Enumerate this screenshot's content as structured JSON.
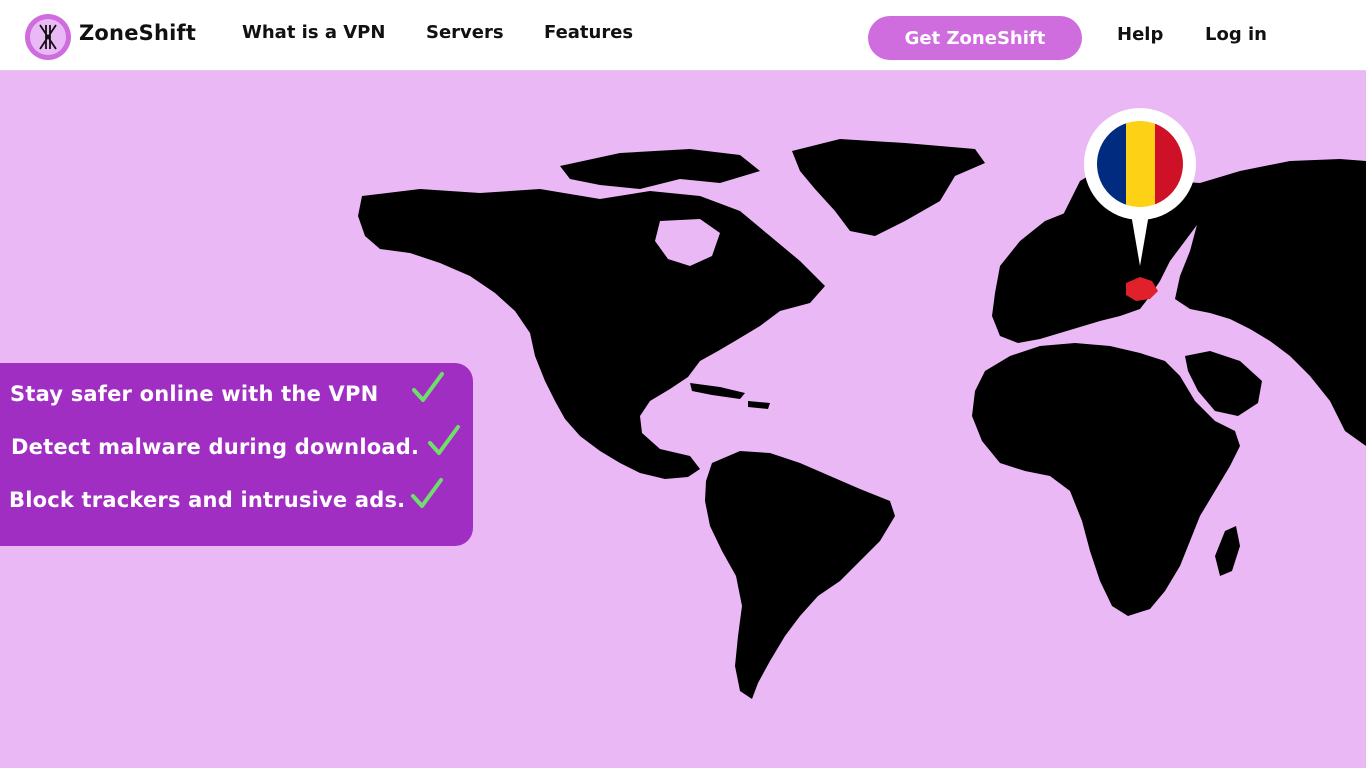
{
  "brand": {
    "name": "ZoneShift",
    "logo_icon": "zoneshift-logo-icon"
  },
  "nav": {
    "what_is_vpn": "What is a VPN",
    "servers": "Servers",
    "features": "Features",
    "cta": "Get ZoneShift",
    "help": "Help",
    "login": "Log in"
  },
  "features": [
    {
      "text": "Stay safer online with the VPN",
      "icon": "check-icon"
    },
    {
      "text": "Detect malware during download.",
      "icon": "check-icon"
    },
    {
      "text": "Block trackers and intrusive ads.",
      "icon": "check-icon"
    }
  ],
  "map": {
    "icon": "world-map",
    "selected_country_flag": "romania-flag-icon",
    "flag_colors": [
      "#002b7f",
      "#fcd116",
      "#ce1126"
    ]
  },
  "colors": {
    "accent": "#cf6ddf",
    "background": "#ebb8f6",
    "card": "#a12ec3",
    "check": "#6ee06a",
    "land": "#000000",
    "highlight": "#e0202a"
  }
}
